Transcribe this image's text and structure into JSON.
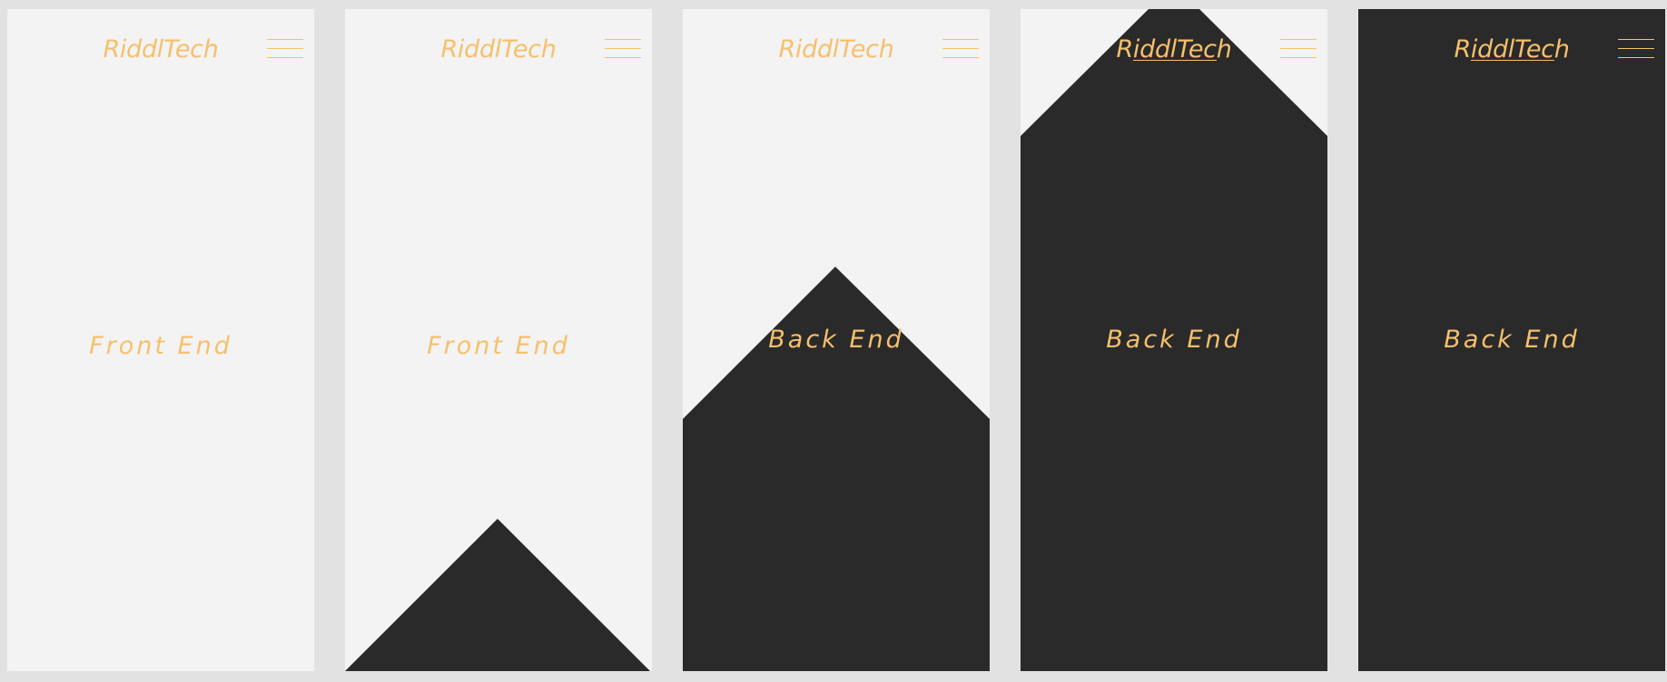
{
  "colors": {
    "page_background": "#e2e2e2",
    "panel_light": "#f3f3f3",
    "panel_dark": "#2a2a2a",
    "accent": "#f6c06b"
  },
  "frames": [
    {
      "logo": "RiddlTech",
      "menu_icon": "hamburger-menu-icon",
      "section_title": "Front End"
    },
    {
      "logo": "RiddlTech",
      "menu_icon": "hamburger-menu-icon",
      "section_title": "Front End"
    },
    {
      "logo": "RiddlTech",
      "menu_icon": "hamburger-menu-icon",
      "section_title": "Back End"
    },
    {
      "logo": "RiddlTech",
      "menu_icon": "hamburger-menu-icon",
      "section_title": "Back End"
    },
    {
      "logo": "RiddlTech",
      "menu_icon": "hamburger-menu-icon",
      "section_title": "Back End"
    }
  ]
}
